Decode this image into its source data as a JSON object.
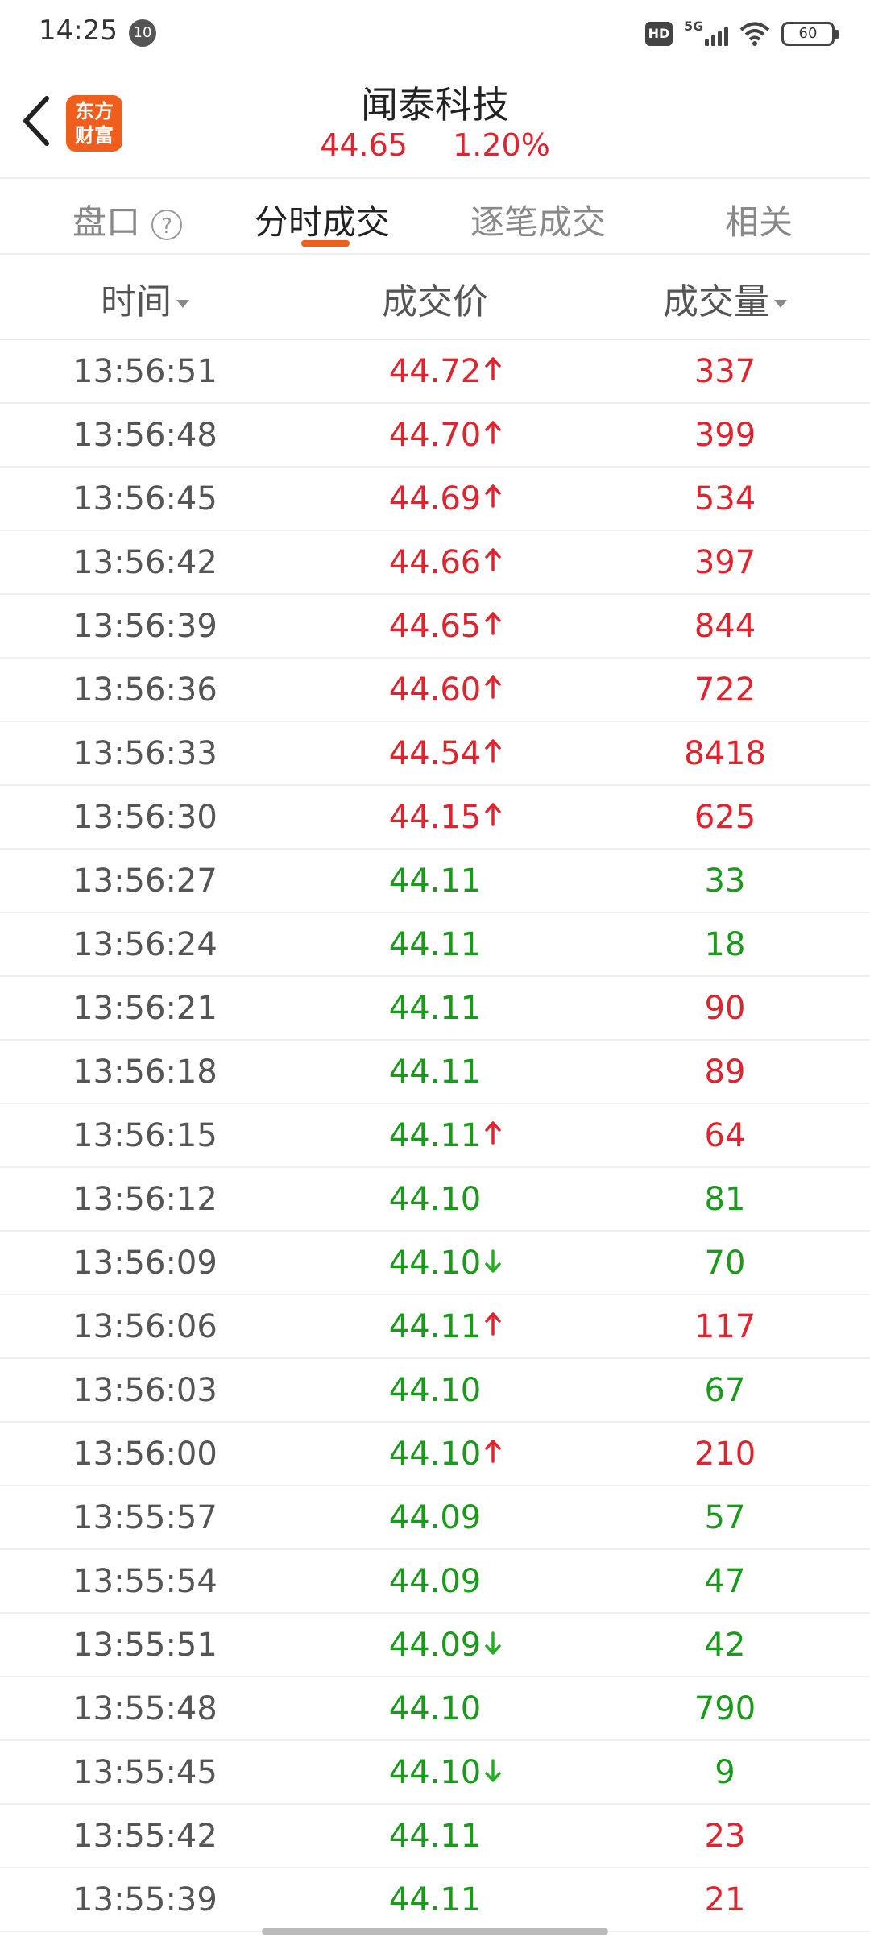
{
  "status_bar": {
    "time": "14:25",
    "notif_badge": "10",
    "hd": "HD",
    "network": "5G",
    "battery": "60"
  },
  "header": {
    "title": "闻泰科技",
    "price": "44.65",
    "change_pct": "1.20%",
    "logo_line1": "东方",
    "logo_line2": "财富"
  },
  "tabs": {
    "pankou": "盘口",
    "help": "?",
    "fenshi": "分时成交",
    "zhubi": "逐笔成交",
    "xiangguan": "相关"
  },
  "columns": {
    "time": "时间",
    "price": "成交价",
    "volume": "成交量"
  },
  "colors": {
    "up": "#e0242e",
    "down": "#1a9a1a",
    "accent": "#ef5e1c"
  },
  "rows": [
    {
      "time": "13:56:51",
      "price": "44.72",
      "arrow": "up",
      "price_dir": "up",
      "volume": "337",
      "vol_dir": "up"
    },
    {
      "time": "13:56:48",
      "price": "44.70",
      "arrow": "up",
      "price_dir": "up",
      "volume": "399",
      "vol_dir": "up"
    },
    {
      "time": "13:56:45",
      "price": "44.69",
      "arrow": "up",
      "price_dir": "up",
      "volume": "534",
      "vol_dir": "up"
    },
    {
      "time": "13:56:42",
      "price": "44.66",
      "arrow": "up",
      "price_dir": "up",
      "volume": "397",
      "vol_dir": "up"
    },
    {
      "time": "13:56:39",
      "price": "44.65",
      "arrow": "up",
      "price_dir": "up",
      "volume": "844",
      "vol_dir": "up"
    },
    {
      "time": "13:56:36",
      "price": "44.60",
      "arrow": "up",
      "price_dir": "up",
      "volume": "722",
      "vol_dir": "up"
    },
    {
      "time": "13:56:33",
      "price": "44.54",
      "arrow": "up",
      "price_dir": "up",
      "volume": "8418",
      "vol_dir": "up"
    },
    {
      "time": "13:56:30",
      "price": "44.15",
      "arrow": "up",
      "price_dir": "up",
      "volume": "625",
      "vol_dir": "up"
    },
    {
      "time": "13:56:27",
      "price": "44.11",
      "arrow": "none",
      "price_dir": "down",
      "volume": "33",
      "vol_dir": "down"
    },
    {
      "time": "13:56:24",
      "price": "44.11",
      "arrow": "none",
      "price_dir": "down",
      "volume": "18",
      "vol_dir": "down"
    },
    {
      "time": "13:56:21",
      "price": "44.11",
      "arrow": "none",
      "price_dir": "down",
      "volume": "90",
      "vol_dir": "up"
    },
    {
      "time": "13:56:18",
      "price": "44.11",
      "arrow": "none",
      "price_dir": "down",
      "volume": "89",
      "vol_dir": "up"
    },
    {
      "time": "13:56:15",
      "price": "44.11",
      "arrow": "up",
      "price_dir": "down",
      "volume": "64",
      "vol_dir": "up"
    },
    {
      "time": "13:56:12",
      "price": "44.10",
      "arrow": "none",
      "price_dir": "down",
      "volume": "81",
      "vol_dir": "down"
    },
    {
      "time": "13:56:09",
      "price": "44.10",
      "arrow": "down",
      "price_dir": "down",
      "volume": "70",
      "vol_dir": "down"
    },
    {
      "time": "13:56:06",
      "price": "44.11",
      "arrow": "up",
      "price_dir": "down",
      "volume": "117",
      "vol_dir": "up"
    },
    {
      "time": "13:56:03",
      "price": "44.10",
      "arrow": "none",
      "price_dir": "down",
      "volume": "67",
      "vol_dir": "down"
    },
    {
      "time": "13:56:00",
      "price": "44.10",
      "arrow": "up",
      "price_dir": "down",
      "volume": "210",
      "vol_dir": "up"
    },
    {
      "time": "13:55:57",
      "price": "44.09",
      "arrow": "none",
      "price_dir": "down",
      "volume": "57",
      "vol_dir": "down"
    },
    {
      "time": "13:55:54",
      "price": "44.09",
      "arrow": "none",
      "price_dir": "down",
      "volume": "47",
      "vol_dir": "down"
    },
    {
      "time": "13:55:51",
      "price": "44.09",
      "arrow": "down",
      "price_dir": "down",
      "volume": "42",
      "vol_dir": "down"
    },
    {
      "time": "13:55:48",
      "price": "44.10",
      "arrow": "none",
      "price_dir": "down",
      "volume": "790",
      "vol_dir": "down"
    },
    {
      "time": "13:55:45",
      "price": "44.10",
      "arrow": "down",
      "price_dir": "down",
      "volume": "9",
      "vol_dir": "down"
    },
    {
      "time": "13:55:42",
      "price": "44.11",
      "arrow": "none",
      "price_dir": "down",
      "volume": "23",
      "vol_dir": "up"
    },
    {
      "time": "13:55:39",
      "price": "44.11",
      "arrow": "none",
      "price_dir": "down",
      "volume": "21",
      "vol_dir": "up"
    }
  ]
}
